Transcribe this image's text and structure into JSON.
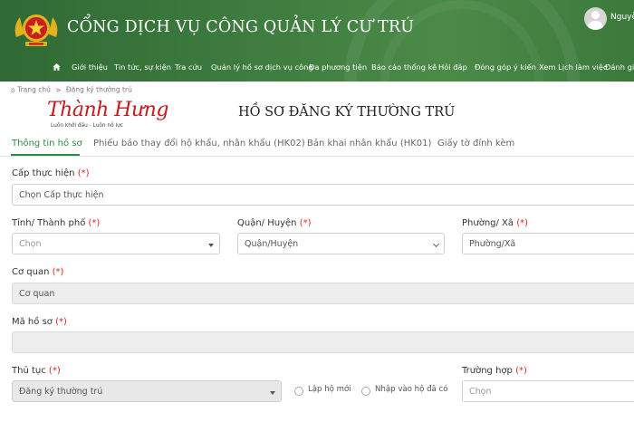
{
  "header": {
    "site_title": "CỔNG DỊCH VỤ CÔNG QUẢN LÝ CƯ TRÚ",
    "user_name": "Nguyễn",
    "nav": [
      "Giới thiệu",
      "Tin tức, sự kiện",
      "Tra cứu",
      "Quản lý hồ sơ dịch vụ công",
      "Đa phương tiện",
      "Báo cáo thống kê",
      "Hỏi đáp",
      "Đóng góp ý kiến",
      "Xem Lịch làm việc",
      "Đánh giá"
    ]
  },
  "breadcrumb": {
    "home": "Trang chủ",
    "separator": ">",
    "current": "Đăng ký thường trú"
  },
  "logo": {
    "brand": "Thành Hưng",
    "slogan": "Luôn khởi đầu - Luôn nỗ lực"
  },
  "page_title": "HỒ SƠ ĐĂNG KÝ THƯỜNG TRÚ",
  "tabs": [
    "Thông tin hồ sơ",
    "Phiếu báo thay đổi hộ khẩu, nhân khẩu (HK02)",
    "Bản khai nhân khẩu (HK01)",
    "Giấy tờ đính kèm"
  ],
  "form": {
    "required_mark": "(*)",
    "cap_thuc_hien": {
      "label": "Cấp thực hiện",
      "value": "Chọn Cấp thực hiện"
    },
    "tinh": {
      "label": "Tỉnh/ Thành phố",
      "placeholder": "Chọn"
    },
    "quan": {
      "label": "Quận/ Huyện",
      "value": "Quận/Huyện"
    },
    "phuong": {
      "label": "Phường/ Xã",
      "value": "Phường/Xã"
    },
    "co_quan": {
      "label": "Cơ quan",
      "value": "Cơ quan"
    },
    "ma_ho_so": {
      "label": "Mã hồ sơ",
      "value": ""
    },
    "thu_tuc": {
      "label": "Thủ tục",
      "value": "Đăng ký thường trú"
    },
    "radio_lap_ho_moi": "Lập hộ mới",
    "radio_nhap_vao_ho": "Nhập vào hộ đã có",
    "truong_hop": {
      "label": "Trường hợp",
      "placeholder": "Chọn"
    }
  },
  "colors": {
    "header_green": "#3e7c3f",
    "active_tab": "#2c8a4b",
    "required": "#d62828",
    "brand_red": "#c8191f"
  }
}
